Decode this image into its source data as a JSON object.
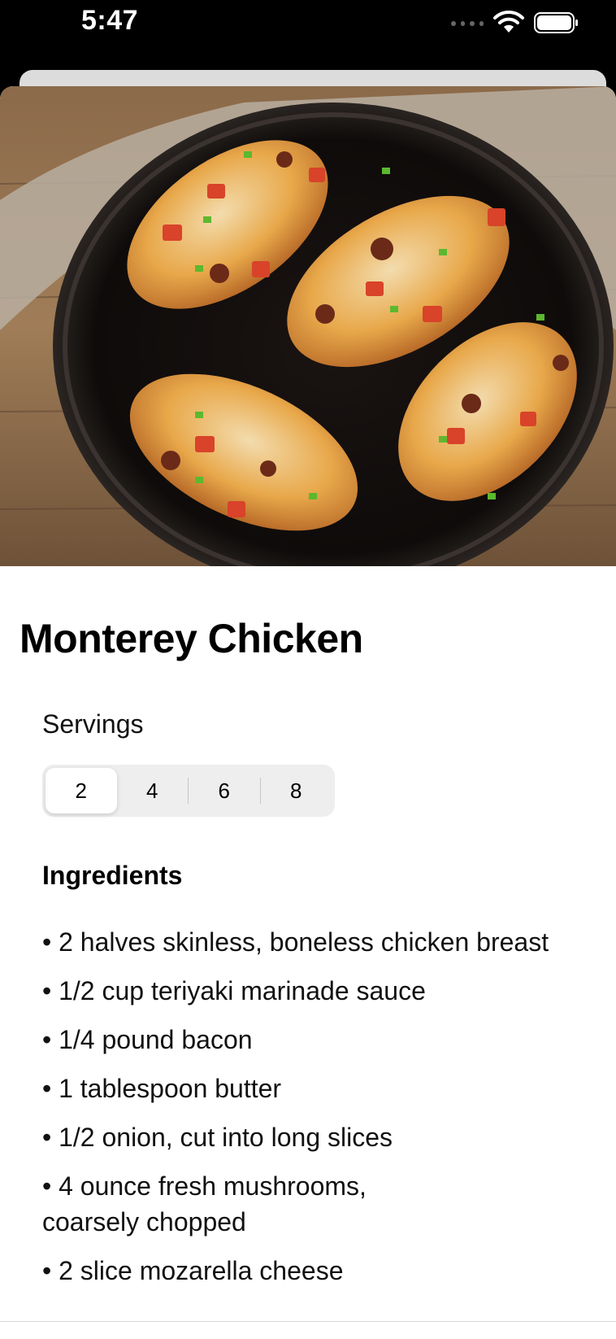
{
  "status_bar": {
    "time": "5:47"
  },
  "recipe": {
    "image_description_icon": "food-photo-icon",
    "title": "Monterey Chicken",
    "servings_label": "Servings",
    "servings_options": [
      "2",
      "4",
      "6",
      "8"
    ],
    "servings_selected": "2",
    "ingredients_title": "Ingredients",
    "ingredients": [
      "• 2 halves skinless, boneless chicken breast",
      "• 1/2 cup teriyaki marinade sauce",
      "• 1/4 pound bacon",
      "• 1 tablespoon butter",
      "• 1/2 onion, cut into long slices",
      "• 4 ounce fresh mushrooms, coarsely chopped",
      "• 2 slice mozarella cheese"
    ]
  },
  "colors": {
    "segment_bg": "#eeeeef",
    "segment_selected": "#ffffff",
    "text": "#000000"
  }
}
